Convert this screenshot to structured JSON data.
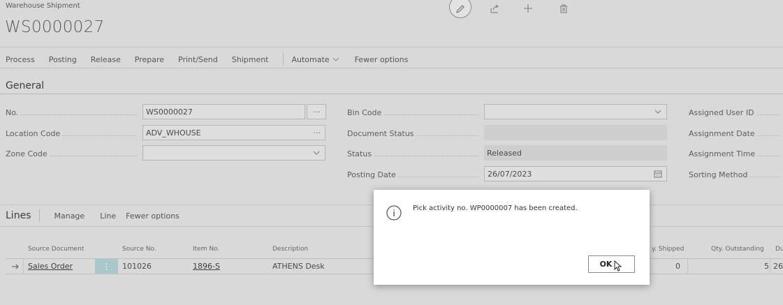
{
  "header": {
    "caption": "Warehouse Shipment",
    "title": "WS0000027"
  },
  "actions": [
    "Process",
    "Posting",
    "Release",
    "Prepare",
    "Print/Send",
    "Shipment"
  ],
  "automate": "Automate",
  "fewer_options": "Fewer options",
  "general": {
    "title": "General",
    "no_label": "No.",
    "no_value": "WS0000027",
    "location_label": "Location Code",
    "location_value": "ADV_WHOUSE",
    "zone_label": "Zone Code",
    "zone_value": "",
    "bin_label": "Bin Code",
    "bin_value": "",
    "docstatus_label": "Document Status",
    "docstatus_value": "",
    "status_label": "Status",
    "status_value": "Released",
    "posting_label": "Posting Date",
    "posting_value": "26/07/2023",
    "assigned_user_label": "Assigned User ID",
    "assignment_date_label": "Assignment Date",
    "assignment_time_label": "Assignment Time",
    "sorting_label": "Sorting Method"
  },
  "lines": {
    "title": "Lines",
    "manage": "Manage",
    "line": "Line",
    "fewer": "Fewer options",
    "headers": {
      "source_document": "Source Document",
      "source_no": "Source No.",
      "item_no": "Item No.",
      "description": "Description",
      "qty_shipped": "y. Shipped",
      "qty_outstanding": "Qty. Outstanding",
      "du": "Du"
    },
    "row": {
      "source_document": "Sales Order",
      "source_no": "101026",
      "item_no": "1896-S",
      "description": "ATHENS Desk",
      "qty_shipped": "0",
      "qty_outstanding": "5",
      "du": "26"
    }
  },
  "dialog": {
    "message": "Pick activity no. WP0000007 has been created.",
    "ok": "OK"
  },
  "icons": {
    "edit": "pencil-icon",
    "share": "share-icon",
    "add": "plus-icon",
    "delete": "trash-icon",
    "info": "info-icon",
    "calendar": "calendar-icon"
  }
}
